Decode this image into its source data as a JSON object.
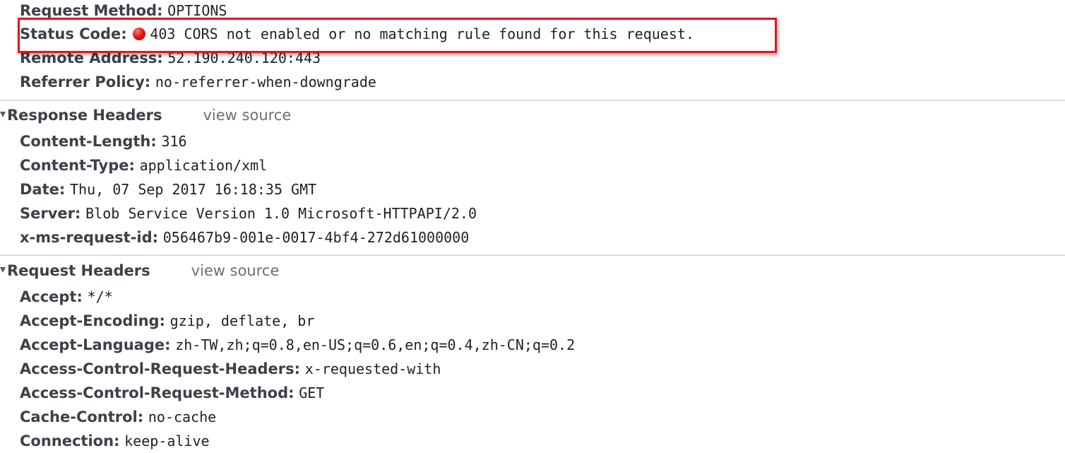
{
  "general": {
    "items": [
      {
        "key": "Request Method:",
        "value": "OPTIONS"
      },
      {
        "key": "Status Code:",
        "value": "403 CORS not enabled or no matching rule found for this request."
      },
      {
        "key": "Remote Address:",
        "value": "52.190.240.120:443"
      },
      {
        "key": "Referrer Policy:",
        "value": "no-referrer-when-downgrade"
      }
    ]
  },
  "response_headers": {
    "title": "Response Headers",
    "view_source": "view source",
    "items": [
      {
        "key": "Content-Length:",
        "value": "316"
      },
      {
        "key": "Content-Type:",
        "value": "application/xml"
      },
      {
        "key": "Date:",
        "value": "Thu, 07 Sep 2017 16:18:35 GMT"
      },
      {
        "key": "Server:",
        "value": "Blob Service Version 1.0 Microsoft-HTTPAPI/2.0"
      },
      {
        "key": "x-ms-request-id:",
        "value": "056467b9-001e-0017-4bf4-272d61000000"
      }
    ]
  },
  "request_headers": {
    "title": "Request Headers",
    "view_source": "view source",
    "items": [
      {
        "key": "Accept:",
        "value": "*/*"
      },
      {
        "key": "Accept-Encoding:",
        "value": "gzip, deflate, br"
      },
      {
        "key": "Accept-Language:",
        "value": "zh-TW,zh;q=0.8,en-US;q=0.6,en;q=0.4,zh-CN;q=0.2"
      },
      {
        "key": "Access-Control-Request-Headers:",
        "value": "x-requested-with"
      },
      {
        "key": "Access-Control-Request-Method:",
        "value": "GET"
      },
      {
        "key": "Cache-Control:",
        "value": "no-cache"
      },
      {
        "key": "Connection:",
        "value": "keep-alive"
      }
    ]
  },
  "colors": {
    "status_error": "#e01b1b",
    "highlight_border": "#e3161c"
  }
}
